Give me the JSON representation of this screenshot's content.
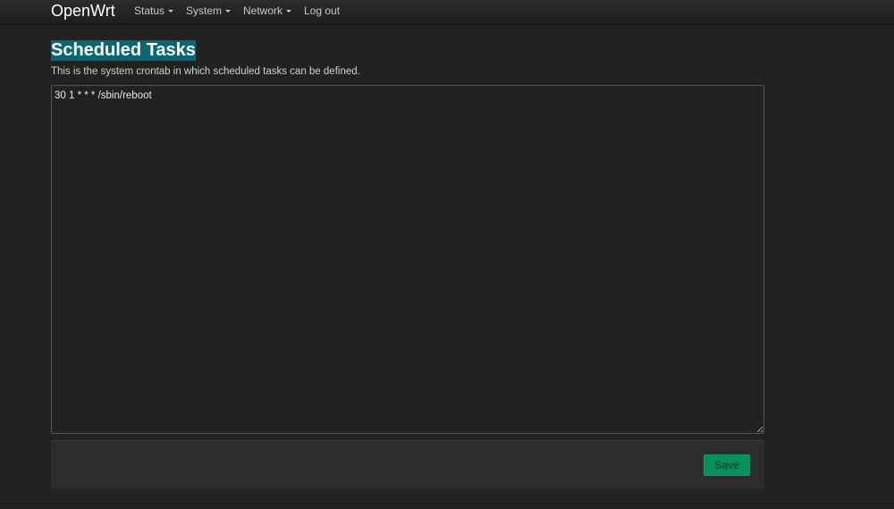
{
  "navbar": {
    "brand": "OpenWrt",
    "items": [
      {
        "label": "Status",
        "has_dropdown": true
      },
      {
        "label": "System",
        "has_dropdown": true
      },
      {
        "label": "Network",
        "has_dropdown": true
      },
      {
        "label": "Log out",
        "has_dropdown": false
      }
    ]
  },
  "page": {
    "title": "Scheduled Tasks",
    "description": "This is the system crontab in which scheduled tasks can be defined.",
    "crontab_value": "30 1 * * * /sbin/reboot"
  },
  "actions": {
    "save_label": "Save"
  },
  "colors": {
    "background": "#222222",
    "title_highlight": "#0b6674",
    "save_button": "#0a8f5b"
  }
}
